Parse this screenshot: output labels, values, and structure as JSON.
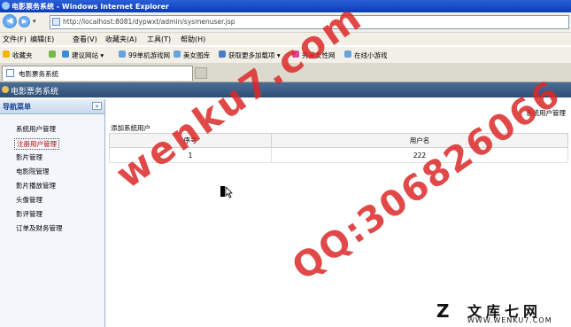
{
  "window": {
    "title": "电影票务系统 - Windows Internet Explorer"
  },
  "address_bar": {
    "url": "http://localhost:8081/dypwxt/admin/sysmenuser.jsp"
  },
  "menu": {
    "items": [
      "文件(F)",
      "编辑(E)",
      "查看(V)",
      "收藏夹(A)",
      "工具(T)",
      "帮助(H)"
    ]
  },
  "favorites": {
    "label": "收藏夹",
    "items": [
      "建议网站 ▾",
      "99单机游戏网",
      "美女图库",
      "获取更多加载项 ▾",
      "秀美女性网",
      "在线小游戏"
    ]
  },
  "tab": {
    "title": "电影票务系统"
  },
  "app": {
    "header_title": "电影票务系统",
    "sidebar": {
      "title": "导航菜单",
      "collapse": "«",
      "items": [
        "系统用户管理",
        "注册用户管理",
        "影片管理",
        "电影院管理",
        "影片播放管理",
        "头像管理",
        "影评管理",
        "订单及财务管理"
      ]
    },
    "breadcrumb": "系统用户管理",
    "add_link": "添加系统用户",
    "table": {
      "headers": [
        "序号",
        "用户名"
      ],
      "rows": [
        [
          "1",
          "222"
        ]
      ]
    }
  },
  "watermark": {
    "line1": "wenku7.com",
    "line2": "QQ:306826066"
  },
  "logo": {
    "mark": "Z",
    "text": "文库七网",
    "url": "WWW.WENKU7.COM"
  }
}
